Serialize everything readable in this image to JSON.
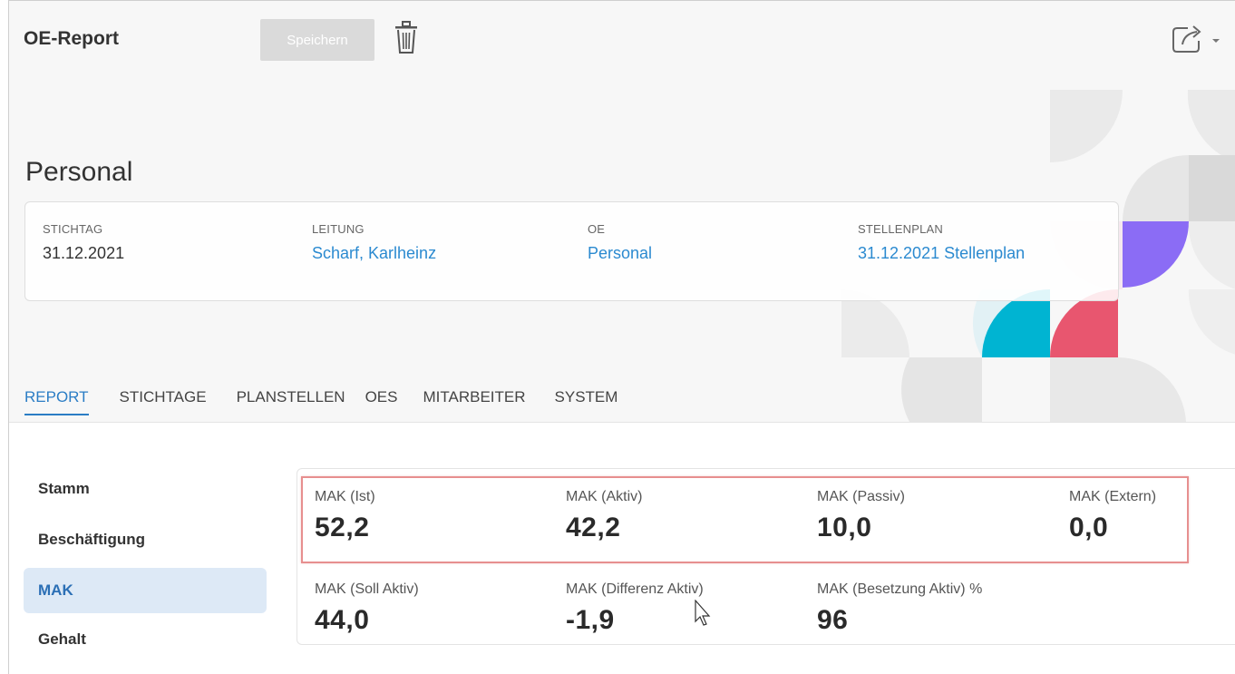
{
  "header": {
    "title": "OE-Report",
    "save_label": "Speichern"
  },
  "page_title": "Personal",
  "info": {
    "stichtag": {
      "label": "STICHTAG",
      "value": "31.12.2021"
    },
    "leitung": {
      "label": "LEITUNG",
      "value": "Scharf, Karlheinz"
    },
    "oe": {
      "label": "OE",
      "value": "Personal"
    },
    "stellenplan": {
      "label": "STELLENPLAN",
      "value": "31.12.2021 Stellenplan"
    }
  },
  "tabs": [
    {
      "label": "REPORT",
      "active": true
    },
    {
      "label": "STICHTAGE"
    },
    {
      "label": "PLANSTELLEN"
    },
    {
      "label": "OES"
    },
    {
      "label": "MITARBEITER"
    },
    {
      "label": "SYSTEM"
    }
  ],
  "sidebar": {
    "items": [
      {
        "label": "Stamm"
      },
      {
        "label": "Beschäftigung"
      },
      {
        "label": "MAK",
        "active": true
      },
      {
        "label": "Gehalt"
      }
    ]
  },
  "metrics": [
    {
      "label": "MAK (Ist)",
      "value": "52,2"
    },
    {
      "label": "MAK (Aktiv)",
      "value": "42,2"
    },
    {
      "label": "MAK (Passiv)",
      "value": "10,0"
    },
    {
      "label": "MAK (Extern)",
      "value": "0,0"
    },
    {
      "label": "MAK (Soll Aktiv)",
      "value": "44,0"
    },
    {
      "label": "MAK (Differenz Aktiv)",
      "value": "-1,9"
    },
    {
      "label": "MAK (Besetzung Aktiv) %",
      "value": "96"
    }
  ],
  "colors": {
    "accent": "#2b7dc5",
    "link": "#2b8ad0",
    "highlight_border": "#e78f8f",
    "deco_purple": "#8b6cf5",
    "deco_cyan": "#00b4d2",
    "deco_red": "#e8566f"
  },
  "icons": {
    "trash": "trash-icon",
    "share": "share-icon",
    "dropdown": "chevron-down-icon"
  }
}
